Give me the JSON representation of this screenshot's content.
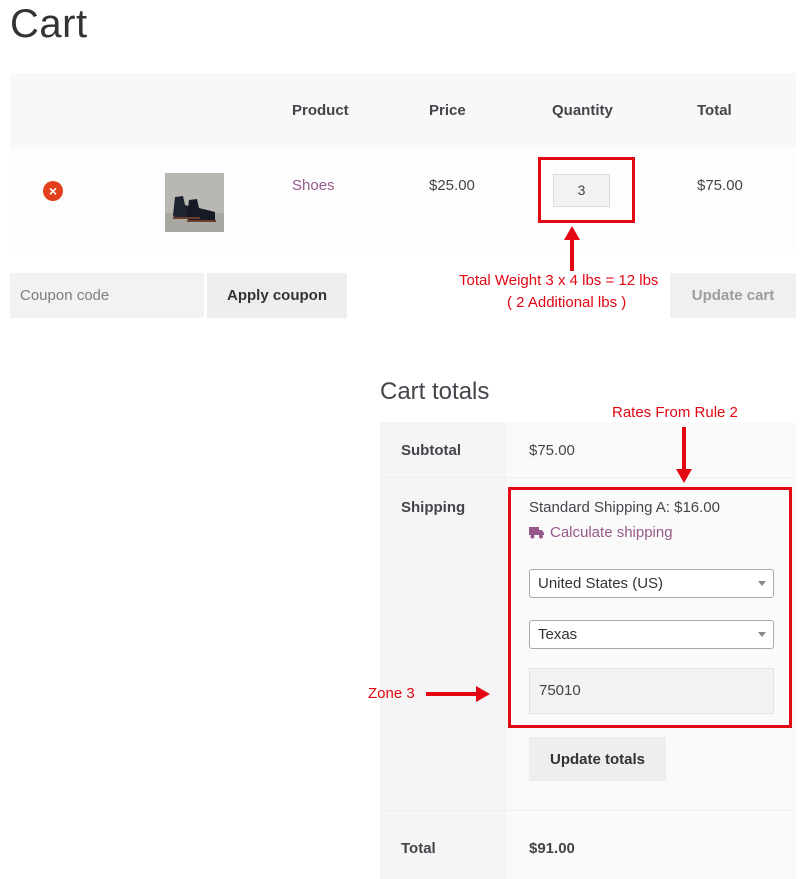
{
  "page": {
    "title": "Cart"
  },
  "cart_table": {
    "headers": {
      "product": "Product",
      "price": "Price",
      "quantity": "Quantity",
      "total": "Total"
    },
    "rows": [
      {
        "product": "Shoes",
        "price": "$25.00",
        "quantity": "3",
        "total": "$75.00"
      }
    ]
  },
  "coupon": {
    "placeholder": "Coupon code",
    "apply_label": "Apply coupon",
    "update_cart_label": "Update cart"
  },
  "totals": {
    "title": "Cart totals",
    "subtotal_label": "Subtotal",
    "subtotal_value": "$75.00",
    "shipping_label": "Shipping",
    "shipping_method": "Standard Shipping A: $16.00",
    "calculate_shipping": "Calculate shipping",
    "country": "United States (US)",
    "state": "Texas",
    "zip": "75010",
    "update_totals_label": "Update totals",
    "total_label": "Total",
    "total_value": "$91.00"
  },
  "annotations": {
    "weight_line1": "Total Weight 3 x 4 lbs = 12 lbs",
    "weight_line2": "( 2 Additional lbs )",
    "rates": "Rates From Rule 2",
    "zone": "Zone 3"
  },
  "colors": {
    "accent": "#96588a",
    "remove": "#e2401c",
    "annotation": "#e30613"
  },
  "icons": {
    "remove": "remove-x-icon",
    "truck": "truck-icon",
    "caret": "chevron-down-icon"
  }
}
